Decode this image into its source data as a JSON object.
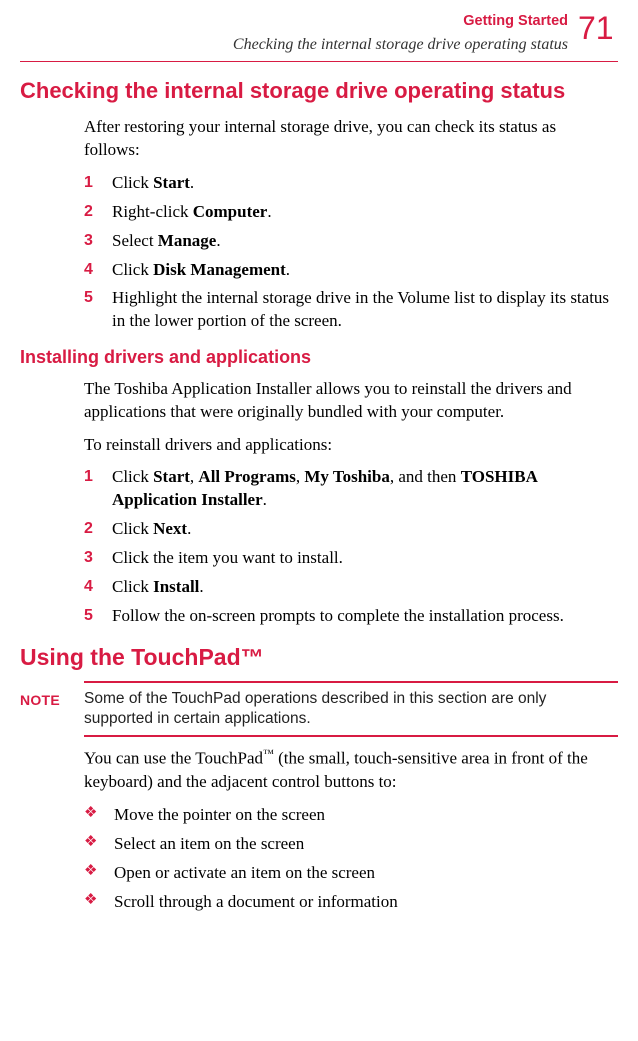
{
  "header": {
    "chapter": "Getting Started",
    "section": "Checking the internal storage drive operating status",
    "page_number": "71"
  },
  "h1": "Checking the internal storage drive operating status",
  "intro1": "After restoring your internal storage drive, you can check its status as follows:",
  "steps1": [
    {
      "n": "1",
      "pre": "Click ",
      "bold": "Start",
      "post": "."
    },
    {
      "n": "2",
      "pre": "Right-click ",
      "bold": "Computer",
      "post": "."
    },
    {
      "n": "3",
      "pre": "Select ",
      "bold": "Manage",
      "post": "."
    },
    {
      "n": "4",
      "pre": "Click ",
      "bold": "Disk Management",
      "post": "."
    },
    {
      "n": "5",
      "pre": "",
      "bold": "",
      "post": "Highlight the internal storage drive in the Volume list to display its status in the lower portion of the screen."
    }
  ],
  "h2": "Installing drivers and applications",
  "intro2a": "The Toshiba Application Installer allows you to reinstall the drivers and applications that were originally bundled with your computer.",
  "intro2b": "To reinstall drivers and applications:",
  "steps2": [
    {
      "n": "1",
      "parts": [
        {
          "t": "Click ",
          "b": false
        },
        {
          "t": "Start",
          "b": true
        },
        {
          "t": ", ",
          "b": false
        },
        {
          "t": "All Programs",
          "b": true
        },
        {
          "t": ", ",
          "b": false
        },
        {
          "t": "My Toshiba",
          "b": true
        },
        {
          "t": ", and then ",
          "b": false
        },
        {
          "t": "TOSHIBA Application Installer",
          "b": true
        },
        {
          "t": ".",
          "b": false
        }
      ]
    },
    {
      "n": "2",
      "parts": [
        {
          "t": "Click ",
          "b": false
        },
        {
          "t": "Next",
          "b": true
        },
        {
          "t": ".",
          "b": false
        }
      ]
    },
    {
      "n": "3",
      "parts": [
        {
          "t": "Click the item you want to install.",
          "b": false
        }
      ]
    },
    {
      "n": "4",
      "parts": [
        {
          "t": "Click ",
          "b": false
        },
        {
          "t": "Install",
          "b": true
        },
        {
          "t": ".",
          "b": false
        }
      ]
    },
    {
      "n": "5",
      "parts": [
        {
          "t": "Follow the on-screen prompts to complete the installation process.",
          "b": false
        }
      ]
    }
  ],
  "h1b_pre": "Using the TouchPad",
  "h1b_tm": "™",
  "note": {
    "label": "NOTE",
    "text": "Some of the TouchPad operations described in this section are only supported in certain applications."
  },
  "intro3_pre": "You can use the TouchPad",
  "intro3_tm": "™",
  "intro3_post": " (the small, touch-sensitive area in front of the keyboard) and the adjacent control buttons to:",
  "bullets": [
    "Move the pointer on the screen",
    "Select an item on the screen",
    "Open or activate an item on the screen",
    "Scroll through a document or information"
  ],
  "diamond": "❖"
}
